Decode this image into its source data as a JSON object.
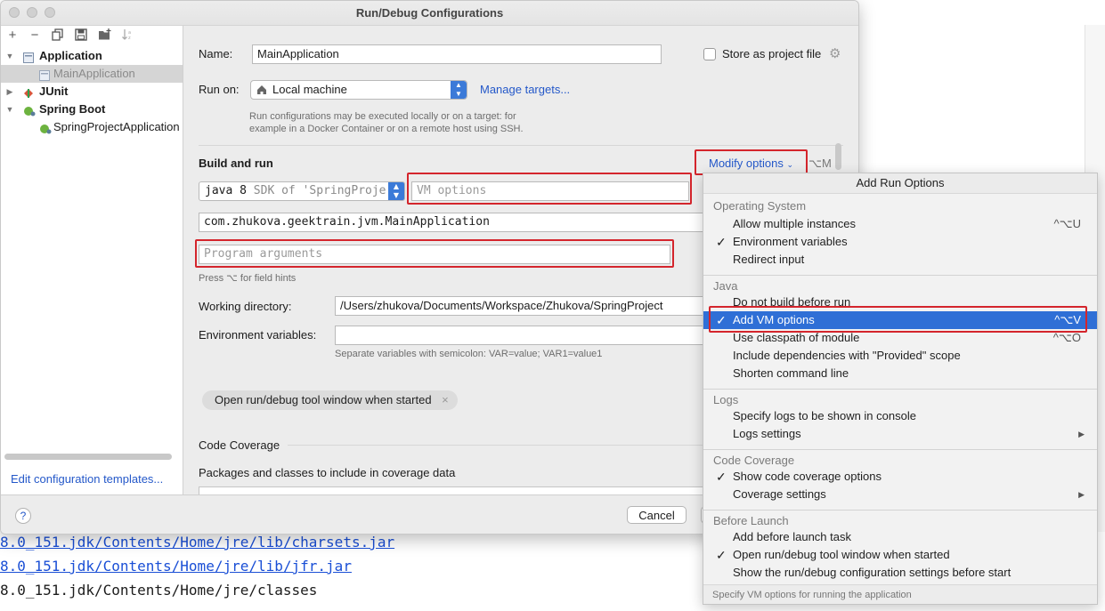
{
  "console": {
    "lines": [
      "8.0_151.jdk/Contents/Home/jre/lib/charsets.jar",
      "8.0_151.jdk/Contents/Home/jre/lib/jfr.jar",
      "8.0_151.jdk/Contents/Home/jre/classes"
    ]
  },
  "dialog": {
    "title": "Run/Debug Configurations",
    "tree": {
      "items": [
        {
          "label": "Application",
          "bold": true
        },
        {
          "label": "MainApplication"
        },
        {
          "label": "JUnit",
          "bold": true
        },
        {
          "label": "Spring Boot",
          "bold": true
        },
        {
          "label": "SpringProjectApplication"
        }
      ],
      "edit_templates": "Edit configuration templates..."
    },
    "name_label": "Name:",
    "name_value": "MainApplication",
    "store_label": "Store as project file",
    "run_on_label": "Run on:",
    "run_on_value": "Local machine",
    "manage_targets": "Manage targets...",
    "run_on_hint": "Run configurations may be executed locally or on a target: for example in a Docker Container or on a remote host using SSH.",
    "build_and_run": "Build and run",
    "modify_options": "Modify options",
    "modify_shortcut": "⌥M",
    "jdk_value": "java 8",
    "jdk_suffix": "SDK of 'SpringProje",
    "vm_options_placeholder": "VM options",
    "main_class": "com.zhukova.geektrain.jvm.MainApplication",
    "program_args_placeholder": "Program arguments",
    "field_hint": "Press ⌥ for field hints",
    "working_dir_label": "Working directory:",
    "working_dir_value": "/Users/zhukova/Documents/Workspace/Zhukova/SpringProject",
    "env_label": "Environment variables:",
    "env_value": "",
    "env_hint": "Separate variables with semicolon: VAR=value; VAR1=value1",
    "chip_label": "Open run/debug tool window when started",
    "chip_close": "×",
    "code_coverage": "Code Coverage",
    "packages_label": "Packages and classes to include in coverage data",
    "help": "?",
    "cancel": "Cancel"
  },
  "popup": {
    "title": "Add Run Options",
    "groups": [
      {
        "header": "Operating System",
        "items": [
          {
            "label": "Allow multiple instances",
            "shortcut": "^⌥U",
            "checked": false
          },
          {
            "label": "Environment variables",
            "checked": true
          },
          {
            "label": "Redirect input",
            "checked": false
          }
        ]
      },
      {
        "header": "Java",
        "items": [
          {
            "label": "Do not build before run",
            "checked": false
          },
          {
            "label": "Add VM options",
            "shortcut": "^⌥V",
            "checked": true,
            "highlighted": true
          },
          {
            "label": "Use classpath of module",
            "shortcut": "^⌥O",
            "checked": false
          },
          {
            "label": "Include dependencies with \"Provided\" scope",
            "checked": false
          },
          {
            "label": "Shorten command line",
            "checked": false
          }
        ]
      },
      {
        "header": "Logs",
        "items": [
          {
            "label": "Specify logs to be shown in console",
            "checked": false
          },
          {
            "label": "Logs settings",
            "submenu": true,
            "checked": false
          }
        ]
      },
      {
        "header": "Code Coverage",
        "items": [
          {
            "label": "Show code coverage options",
            "checked": true
          },
          {
            "label": "Coverage settings",
            "submenu": true,
            "checked": false
          }
        ]
      },
      {
        "header": "Before Launch",
        "items": [
          {
            "label": "Add before launch task",
            "checked": false
          },
          {
            "label": "Open run/debug tool window when started",
            "checked": true
          },
          {
            "label": "Show the run/debug configuration settings before start",
            "checked": false
          }
        ]
      }
    ],
    "footer": "Specify VM options for running the application"
  },
  "colors": {
    "accent": "#2f6fd6",
    "highlight_box": "#d4252c",
    "link": "#2458c9"
  },
  "icons": [
    "add-icon",
    "remove-icon",
    "copy-icon",
    "save-icon",
    "folder-add-icon",
    "sort-icon",
    "gear-icon",
    "home-icon",
    "chevron-down-icon",
    "checkmark-icon",
    "submenu-arrow-icon",
    "help-icon"
  ]
}
